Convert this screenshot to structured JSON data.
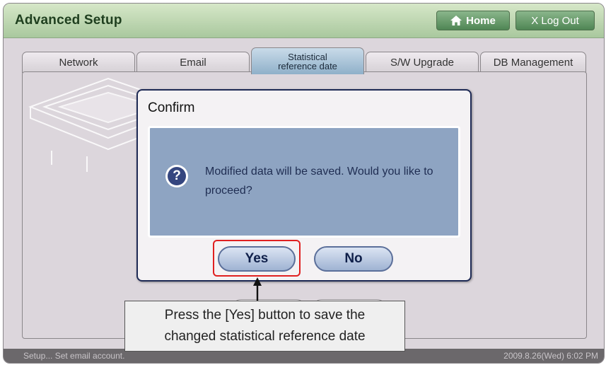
{
  "app": {
    "title": "Advanced Setup"
  },
  "header": {
    "home_label": "Home",
    "logout_label": "X Log Out"
  },
  "tabs": [
    {
      "label": "Network"
    },
    {
      "label": "Email"
    },
    {
      "label_line1": "Statistical",
      "label_line2": "reference date",
      "active": true
    },
    {
      "label": "S/W Upgrade"
    },
    {
      "label": "DB Management"
    }
  ],
  "dialog": {
    "title": "Confirm",
    "icon": "question-icon",
    "message": "Modified data will be saved.  Would you like to proceed?",
    "yes_label": "Yes",
    "no_label": "No"
  },
  "callout": {
    "line1": "Press the [Yes] button to save the",
    "line2": "changed statistical reference date"
  },
  "status": {
    "left": "Setup... Set email account.",
    "right": "2009.8.26(Wed)  6:02 PM"
  },
  "colors": {
    "accent": "#4f8654",
    "dialog_body": "#8ea4c2",
    "highlight": "#e02020"
  }
}
